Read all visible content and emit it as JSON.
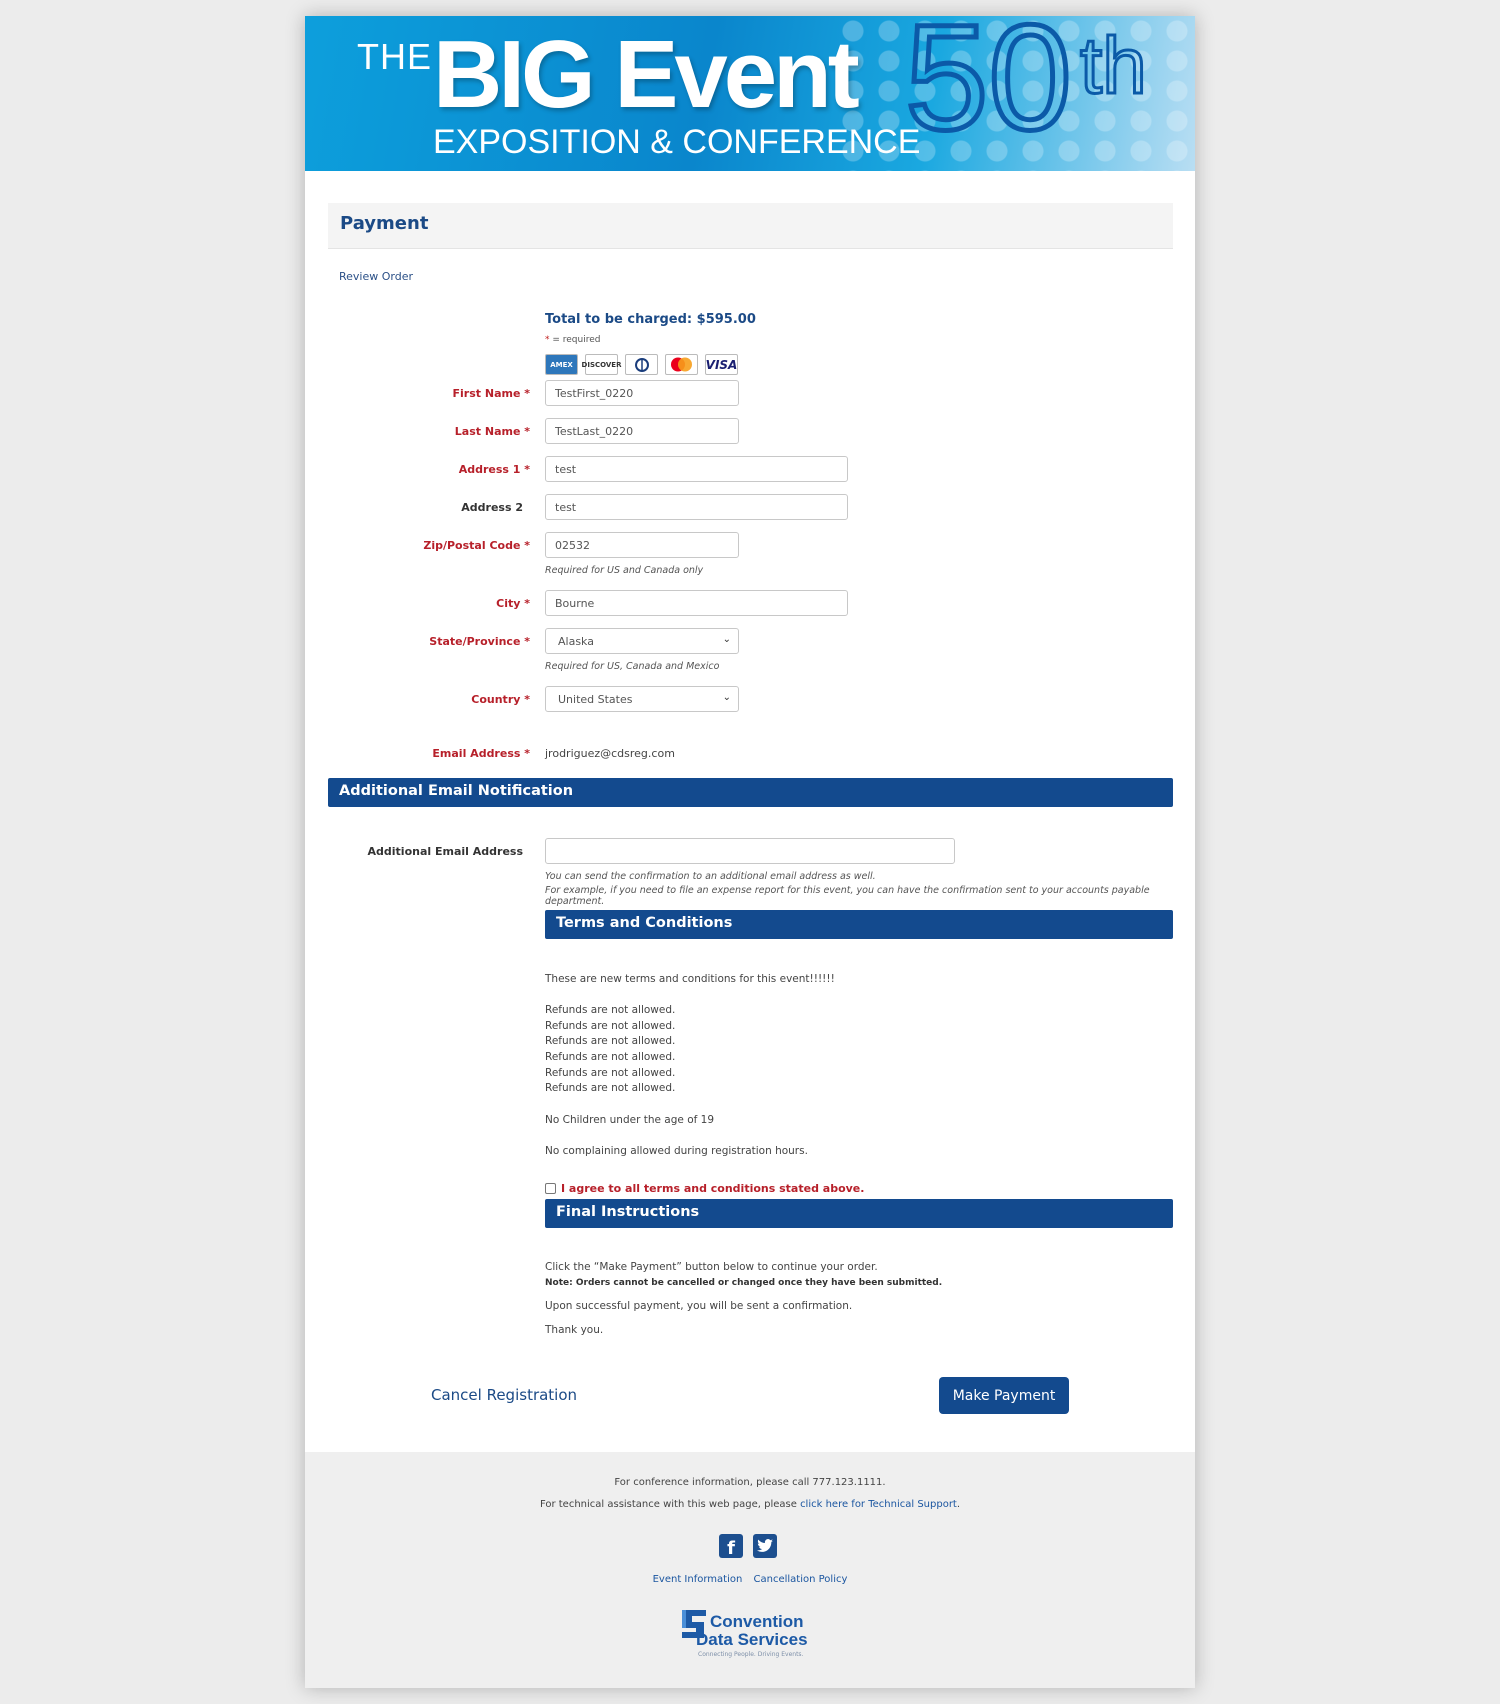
{
  "banner": {
    "the": "THE",
    "big_event": "BIG Event",
    "subtitle": "EXPOSITION & CONFERENCE",
    "fifty": "50",
    "th": "th"
  },
  "page": {
    "section_title": "Payment",
    "review_order": "Review Order",
    "total": "Total to be charged: $595.00",
    "required_star": "*",
    "required_text": " = required"
  },
  "cards": [
    "AMEX",
    "DISCOVER",
    "Diners",
    "mastercard",
    "VISA"
  ],
  "form": {
    "first_name_label": "First Name *",
    "first_name_value": "TestFirst_0220",
    "last_name_label": "Last Name *",
    "last_name_value": "TestLast_0220",
    "address1_label": "Address 1 *",
    "address1_value": "test",
    "address2_label": "Address 2",
    "address2_value": "test",
    "zip_label": "Zip/Postal Code *",
    "zip_value": "02532",
    "zip_hint": "Required for US and Canada only",
    "city_label": "City *",
    "city_value": "Bourne",
    "state_label": "State/Province *",
    "state_value": "Alaska",
    "state_hint": "Required for US, Canada and Mexico",
    "country_label": "Country *",
    "country_value": "United States",
    "email_label": "Email Address *",
    "email_value": "jrodriguez@cdsreg.com"
  },
  "additional": {
    "title": "Additional Email Notification",
    "label": "Additional Email Address",
    "value": "",
    "hint1": "You can send the confirmation to an additional email address as well.",
    "hint2": "For example, if you need to file an expense report for this event, you can have the confirmation sent to your accounts payable department."
  },
  "terms": {
    "title": "Terms and Conditions",
    "intro": "These are new terms and conditions for this event!!!!!!",
    "refunds": [
      "Refunds are not allowed.",
      "Refunds are not allowed.",
      "Refunds are not allowed.",
      "Refunds are not allowed.",
      "Refunds are not allowed.",
      "Refunds are not allowed."
    ],
    "children": "No Children under the age of 19",
    "complaining": "No complaining allowed during registration hours.",
    "agree": "I agree to all terms and conditions stated above."
  },
  "final": {
    "title": "Final Instructions",
    "line1": "Click the “Make Payment” button below to continue your order.",
    "note": "Note: Orders cannot be cancelled or changed once they have been submitted.",
    "line2": "Upon successful payment, you will be sent a confirmation.",
    "line3": "Thank you."
  },
  "actions": {
    "cancel": "Cancel Registration",
    "pay": "Make Payment"
  },
  "footer": {
    "info": "For conference information, please call 777.123.1111.",
    "tech_prefix": "For technical assistance with this web page, please ",
    "tech_link": "click here for Technical Support",
    "tech_suffix": ".",
    "event_info": "Event Information",
    "cancellation": "Cancellation Policy",
    "logo_line1": "Convention",
    "logo_line2": "Data Services",
    "logo_tagline": "Connecting People. Driving Events."
  }
}
